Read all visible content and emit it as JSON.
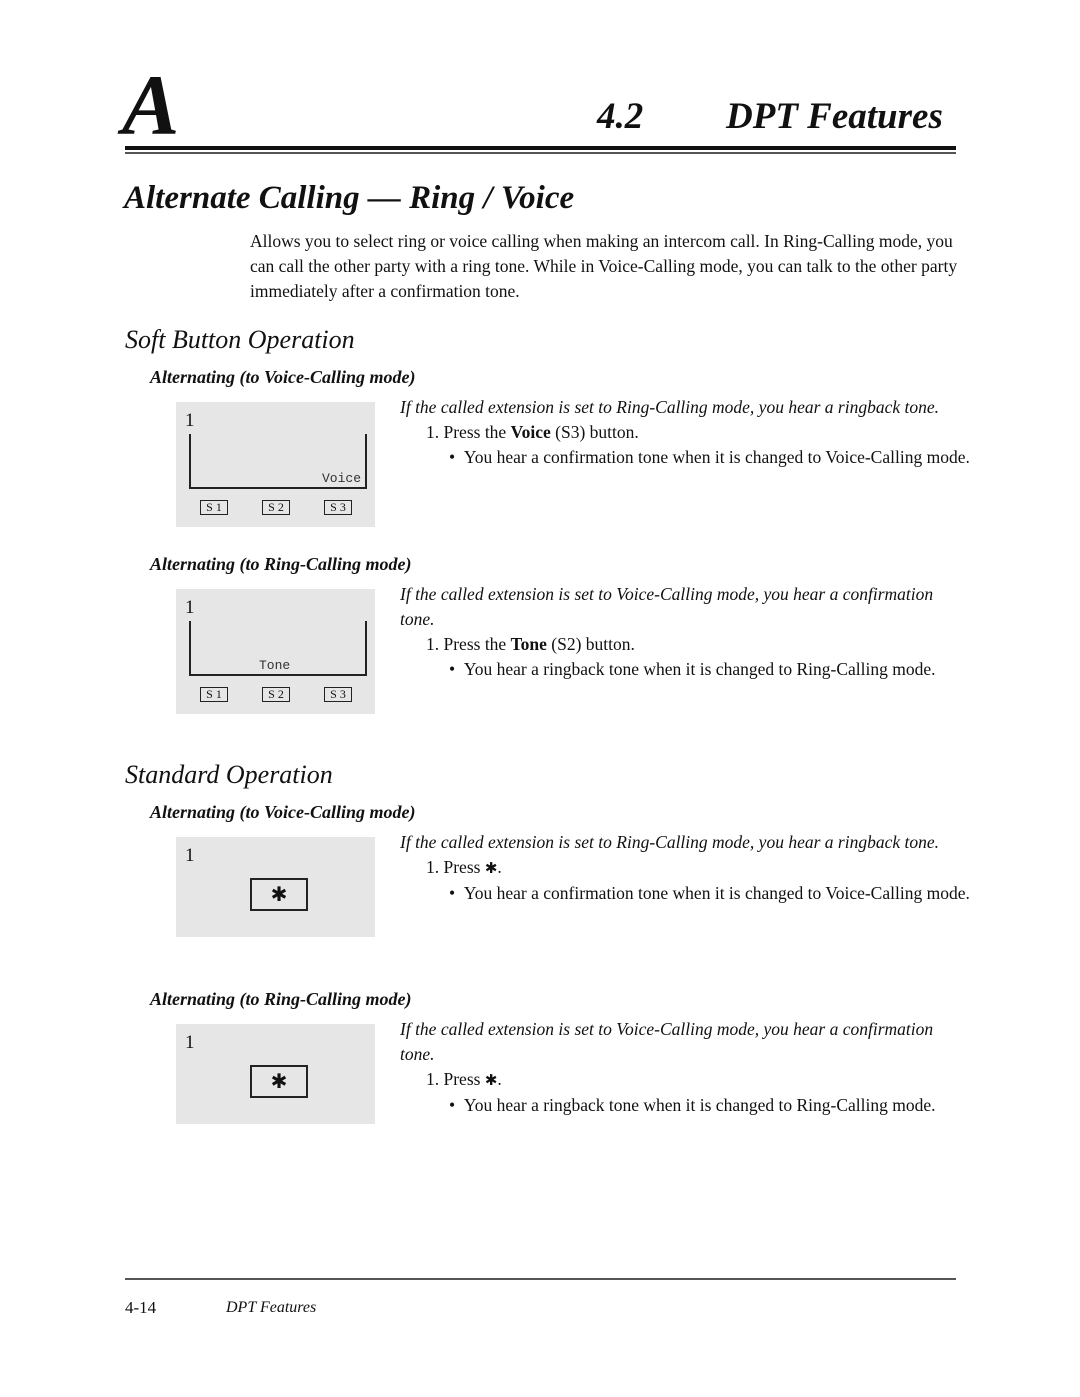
{
  "header": {
    "chapter_letter": "A",
    "section_number": "4.2",
    "section_title": "DPT Features"
  },
  "page_title": "Alternate Calling — Ring / Voice",
  "intro": "Allows you to select ring or voice calling when making an intercom call.  In Ring-Calling mode, you can call the other party with a ring tone.  While in Voice-Calling mode, you can talk to the other party immediately after a confirmation tone.",
  "soft_button": {
    "heading": "Soft Button Operation",
    "voice_mode": {
      "heading": "Alternating (to Voice-Calling mode)",
      "display": {
        "line_number": "1",
        "lcd_label": "Voice",
        "softkeys": [
          "S 1",
          "S 2",
          "S 3"
        ]
      },
      "condition": "If the called extension is set to Ring-Calling mode, you hear a ringback tone.",
      "step_prefix": "1.  Press the ",
      "step_bold": "Voice",
      "step_suffix": " (S3) button.",
      "bullet": "You hear a confirmation tone when it is changed to Voice-Calling mode."
    },
    "ring_mode": {
      "heading": "Alternating (to Ring-Calling mode)",
      "display": {
        "line_number": "1",
        "lcd_label": "Tone",
        "softkeys": [
          "S 1",
          "S 2",
          "S 3"
        ]
      },
      "condition": "If the called extension is set to Voice-Calling mode, you hear a confirmation tone.",
      "step_prefix": "1.  Press the ",
      "step_bold": "Tone",
      "step_suffix": " (S2) button.",
      "bullet": "You hear a ringback tone when it is changed to Ring-Calling mode."
    }
  },
  "standard": {
    "heading": "Standard Operation",
    "voice_mode": {
      "heading": "Alternating (to Voice-Calling mode)",
      "display": {
        "line_number": "1",
        "key_symbol": "✱"
      },
      "condition": "If the called extension is set to Ring-Calling mode, you hear a ringback tone.",
      "step_prefix": "1.  Press ",
      "step_symbol": "✱",
      "step_suffix": ".",
      "bullet": "You hear a confirmation tone when it is changed to Voice-Calling mode."
    },
    "ring_mode": {
      "heading": "Alternating (to Ring-Calling mode)",
      "display": {
        "line_number": "1",
        "key_symbol": "✱"
      },
      "condition": "If the called extension is set to Voice-Calling mode, you hear a confirmation tone.",
      "step_prefix": "1.  Press ",
      "step_symbol": "✱",
      "step_suffix": ".",
      "bullet": "You hear a ringback tone when it is changed to Ring-Calling mode."
    }
  },
  "bullet_glyph": "•",
  "footer": {
    "page_number": "4-14",
    "title": "DPT Features"
  }
}
